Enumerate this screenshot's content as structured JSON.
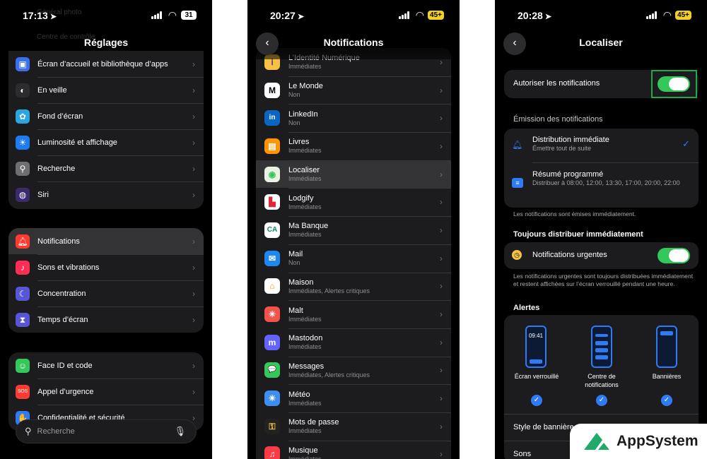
{
  "phone1": {
    "time": "17:13",
    "battery": "31",
    "title": "Réglages",
    "faded_items": [
      "Général photo",
      "Centre de contrôle"
    ],
    "group1": [
      {
        "icon": "home-screen-icon",
        "label": "Écran d’accueil et bibliothèque d’apps",
        "color": "#3a6ff0"
      },
      {
        "icon": "standby-icon",
        "label": "En veille",
        "color": "#2c2c2e"
      },
      {
        "icon": "wallpaper-icon",
        "label": "Fond d’écran",
        "color": "#2aa6e0"
      },
      {
        "icon": "brightness-icon",
        "label": "Luminosité et affichage",
        "color": "#1f7bf0"
      },
      {
        "icon": "search-icon",
        "label": "Recherche",
        "color": "#6e6e73"
      },
      {
        "icon": "siri-icon",
        "label": "Siri",
        "color": "#3b2a6e"
      }
    ],
    "group2": [
      {
        "icon": "notifications-icon",
        "label": "Notifications",
        "color": "#ff3b30"
      },
      {
        "icon": "sounds-icon",
        "label": "Sons et vibrations",
        "color": "#ff2d55"
      },
      {
        "icon": "focus-icon",
        "label": "Concentration",
        "color": "#5856d6"
      },
      {
        "icon": "screen-time-icon",
        "label": "Temps d’écran",
        "color": "#5856d6"
      }
    ],
    "group3": [
      {
        "icon": "face-id-icon",
        "label": "Face ID et code",
        "color": "#34c759"
      },
      {
        "icon": "sos-icon",
        "label": "Appel d’urgence",
        "color": "#ff3b30"
      },
      {
        "icon": "privacy-icon",
        "label": "Confidentialité et sécurité",
        "color": "#2f7bf5"
      }
    ],
    "search_placeholder": "Recherche"
  },
  "phone2": {
    "time": "20:27",
    "battery": "45+",
    "title": "Notifications",
    "apps": [
      {
        "name": "L’Identité Numérique",
        "sub": "Immédiates",
        "bg": "#f6c244",
        "fg": "#5b2d8a",
        "glyph": "ⅰ"
      },
      {
        "name": "Le Monde",
        "sub": "Non",
        "bg": "#ffffff",
        "fg": "#000000",
        "glyph": "M"
      },
      {
        "name": "LinkedIn",
        "sub": "Non",
        "bg": "#0a66c2",
        "fg": "#ffffff",
        "glyph": "in"
      },
      {
        "name": "Livres",
        "sub": "Immédiates",
        "bg": "#ff9500",
        "fg": "#ffffff",
        "glyph": "▤"
      },
      {
        "name": "Localiser",
        "sub": "Immédiates",
        "bg": "#e9f3e2",
        "fg": "#34c759",
        "glyph": "◉"
      },
      {
        "name": "Lodgify",
        "sub": "Immédiates",
        "bg": "#ffffff",
        "fg": "#e0253a",
        "glyph": "▙"
      },
      {
        "name": "Ma Banque",
        "sub": "Immédiates",
        "bg": "#ffffff",
        "fg": "#0a8a6a",
        "glyph": "CA"
      },
      {
        "name": "Mail",
        "sub": "Non",
        "bg": "#1e88f0",
        "fg": "#ffffff",
        "glyph": "✉"
      },
      {
        "name": "Maison",
        "sub": "Immédiates, Alertes critiques",
        "bg": "#ffffff",
        "fg": "#ff9500",
        "glyph": "⌂"
      },
      {
        "name": "Malt",
        "sub": "Immédiates",
        "bg": "#f4534b",
        "fg": "#ffffff",
        "glyph": "✳"
      },
      {
        "name": "Mastodon",
        "sub": "Immédiates",
        "bg": "#6364ff",
        "fg": "#ffffff",
        "glyph": "m"
      },
      {
        "name": "Messages",
        "sub": "Immédiates, Alertes critiques",
        "bg": "#34c759",
        "fg": "#ffffff",
        "glyph": "💬"
      },
      {
        "name": "Météo",
        "sub": "Immédiates",
        "bg": "#3d8ef0",
        "fg": "#ffffff",
        "glyph": "☀"
      },
      {
        "name": "Mots de passe",
        "sub": "Immédiates",
        "bg": "#222222",
        "fg": "#f6c244",
        "glyph": "⚿"
      },
      {
        "name": "Musique",
        "sub": "Immédiates",
        "bg": "#fc3c44",
        "fg": "#ffffff",
        "glyph": "♫"
      }
    ]
  },
  "phone3": {
    "time": "20:28",
    "battery": "45+",
    "title": "Localiser",
    "allow_label": "Autoriser les notifications",
    "delivery_header": "Émission des notifications",
    "immediate_title": "Distribution immédiate",
    "immediate_desc": "Émettre tout de suite",
    "summary_title": "Résumé programmé",
    "summary_desc": "Distribuer à 08:00, 12:00, 13:30, 17:00, 20:00, 22:00",
    "delivery_note": "Les notifications sont émises immédiatement.",
    "always_header": "Toujours distribuer immédiatement",
    "urgent_label": "Notifications urgentes",
    "urgent_note": "Les notifications urgentes sont toujours distribuées immédiatement et restent affichées sur l’écran verrouillé pendant une heure.",
    "alerts_header": "Alertes",
    "lock_time": "09:41",
    "alert_lock": "Écran verrouillé",
    "alert_center": "Centre de notifications",
    "alert_banners": "Bannières",
    "banner_style": "Style de bannière",
    "sounds": "Sons"
  },
  "brand": {
    "name": "AppSystem",
    "color": "#1faa6a"
  }
}
